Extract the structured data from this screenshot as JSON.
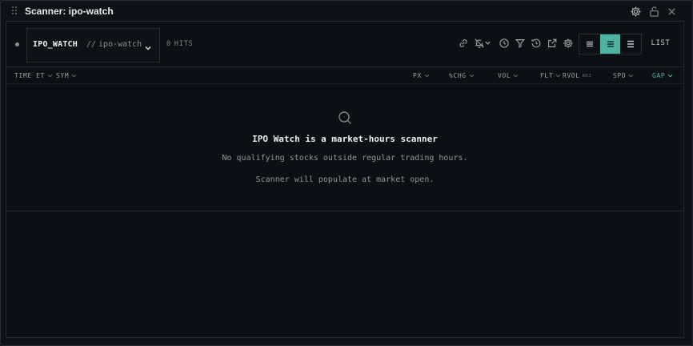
{
  "window": {
    "title": "Scanner: ipo-watch",
    "icons": [
      "drag-handle-icon",
      "gear-icon",
      "unlock-icon",
      "close-icon"
    ]
  },
  "toolbar": {
    "watch_name": "IPO_WATCH",
    "separator": "//",
    "watch_id": "ipo-watch",
    "hits_count": "0",
    "hits_label": "HITS",
    "tool_icons": [
      "link-icon",
      "bell-off-icon",
      "chevron-down-icon",
      "clock-icon",
      "filter-icon",
      "history-icon",
      "external-link-icon",
      "gear-icon"
    ],
    "view_modes": [
      "compact",
      "normal",
      "expanded"
    ],
    "active_view": "normal",
    "list_label": "LIST"
  },
  "columns": {
    "time": "TIME ET",
    "sym": "SYM",
    "px": "PX",
    "chg": "%CHG",
    "vol": "VOL",
    "flt": "FLT",
    "rvol": "RVOL",
    "rvol_tag": "ADJ",
    "spd": "SPD",
    "gap": "GAP",
    "sorted_by": "GAP"
  },
  "empty_state": {
    "icon": "search-icon",
    "title": "IPO Watch is a market-hours scanner",
    "message": "No qualifying stocks outside regular trading hours.",
    "sub_message": "Scanner will populate at market open."
  },
  "colors": {
    "accent": "#4fb3a3",
    "background": "#0e1115",
    "border": "#2a2f36",
    "muted_text": "#8f959d"
  }
}
